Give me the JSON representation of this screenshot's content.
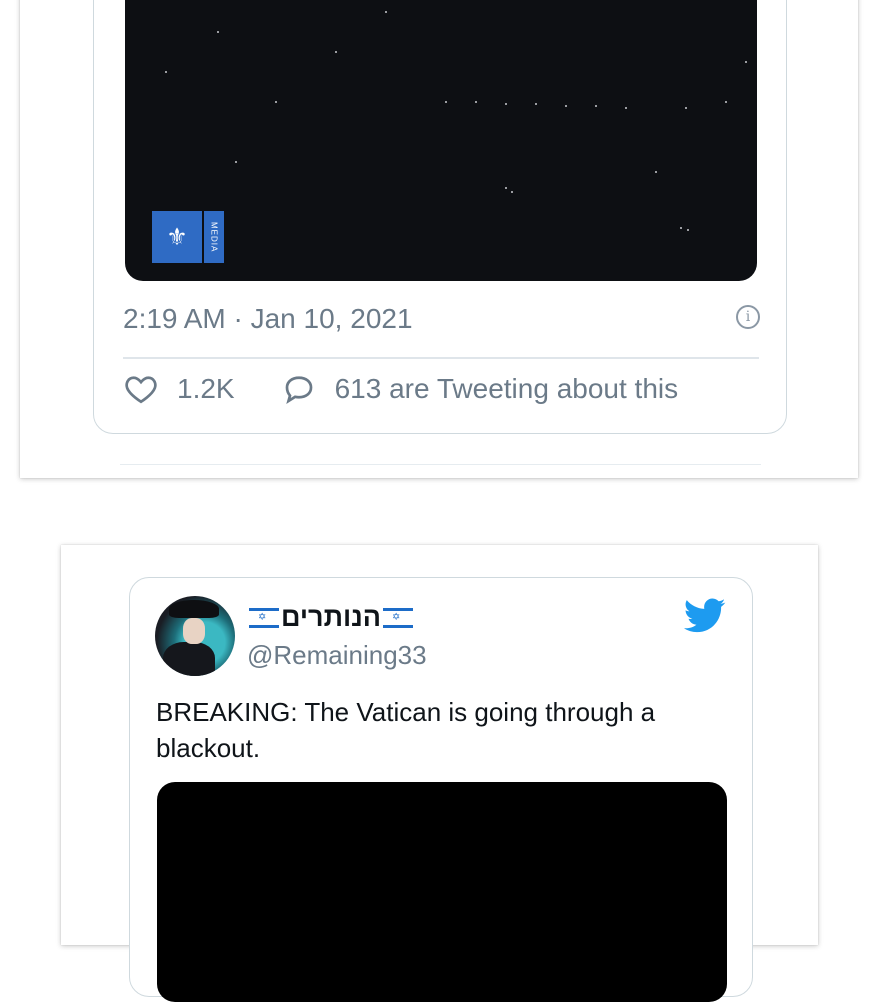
{
  "tweet1": {
    "timestamp": "2:19 AM · Jan 10, 2021",
    "likes": "1.2K",
    "tweeting": "613 are Tweeting about this",
    "media_logo_text": "MEDIA"
  },
  "tweet2": {
    "display_name": "הנותרים",
    "handle": "@Remaining33",
    "text": "BREAKING: The Vatican is going through a blackout."
  },
  "colors": {
    "twitter_blue": "#1d9bf0",
    "muted_text": "#6b7a88",
    "border": "#cfd9de"
  }
}
